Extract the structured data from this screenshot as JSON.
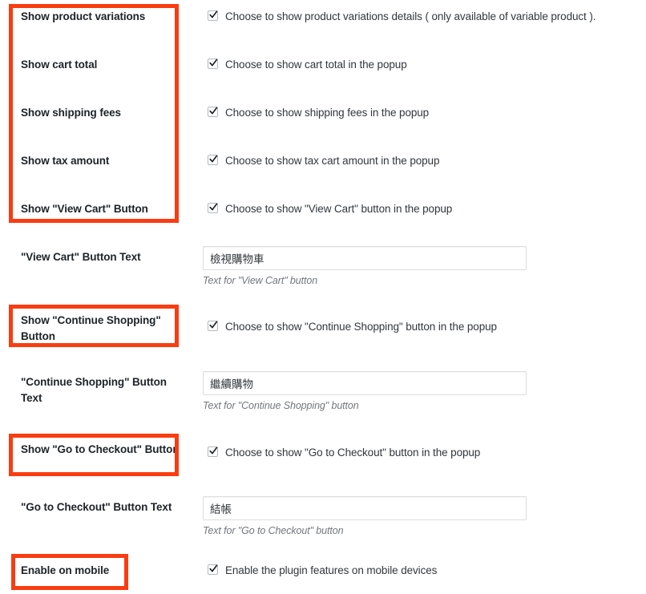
{
  "page": {
    "accent_color": "#f93c11",
    "background": "#ffffff",
    "checkbox_icon": "check-icon"
  },
  "rows": [
    {
      "id": "show-product-variations",
      "label": "Show product variations",
      "type": "checkbox",
      "checked": true,
      "description": "Choose to show product variations details ( only available of variable product )."
    },
    {
      "id": "show-cart-total",
      "label": "Show cart total",
      "type": "checkbox",
      "checked": true,
      "description": "Choose to show cart total in the popup"
    },
    {
      "id": "show-shipping-fees",
      "label": "Show shipping fees",
      "type": "checkbox",
      "checked": true,
      "description": "Choose to show shipping fees in the popup"
    },
    {
      "id": "show-tax-amount",
      "label": "Show tax amount",
      "type": "checkbox",
      "checked": true,
      "description": "Choose to show tax cart amount in the popup"
    },
    {
      "id": "show-view-cart-button",
      "label": "Show \"View Cart\" Button",
      "type": "checkbox",
      "checked": true,
      "description": "Choose to show \"View Cart\" button in the popup"
    },
    {
      "id": "view-cart-button-text",
      "label": "\"View Cart\" Button Text",
      "type": "text",
      "value": "檢視購物車",
      "placeholder": "",
      "help": "Text for \"View Cart\" button"
    },
    {
      "id": "show-continue-shopping-button",
      "label": "Show \"Continue Shopping\" Button",
      "type": "checkbox",
      "checked": true,
      "description": "Choose to show \"Continue Shopping\" button in the popup"
    },
    {
      "id": "continue-shopping-button-text",
      "label": "\"Continue Shopping\" Button Text",
      "type": "text",
      "value": "繼續購物",
      "placeholder": "",
      "help": "Text for \"Continue Shopping\" button"
    },
    {
      "id": "show-go-to-checkout-button",
      "label": "Show \"Go to Checkout\" Button",
      "type": "checkbox",
      "checked": true,
      "description": "Choose to show \"Go to Checkout\" button in the popup"
    },
    {
      "id": "go-to-checkout-button-text",
      "label": "\"Go to Checkout\" Button Text",
      "type": "text",
      "value": "結帳",
      "placeholder": "",
      "help": "Text for \"Go to Checkout\" button"
    },
    {
      "id": "enable-on-mobile",
      "label": "Enable on mobile",
      "type": "checkbox",
      "checked": true,
      "description": "Enable the plugin features on mobile devices"
    }
  ],
  "annotations": [
    {
      "id": "annotation-checkbox-group",
      "target": "rows 0-4 labels"
    },
    {
      "id": "annotation-continue-shopping-label",
      "target": "show-continue-shopping-button label"
    },
    {
      "id": "annotation-go-to-checkout-label",
      "target": "show-go-to-checkout-button label"
    },
    {
      "id": "annotation-enable-on-mobile-label",
      "target": "enable-on-mobile label"
    }
  ]
}
